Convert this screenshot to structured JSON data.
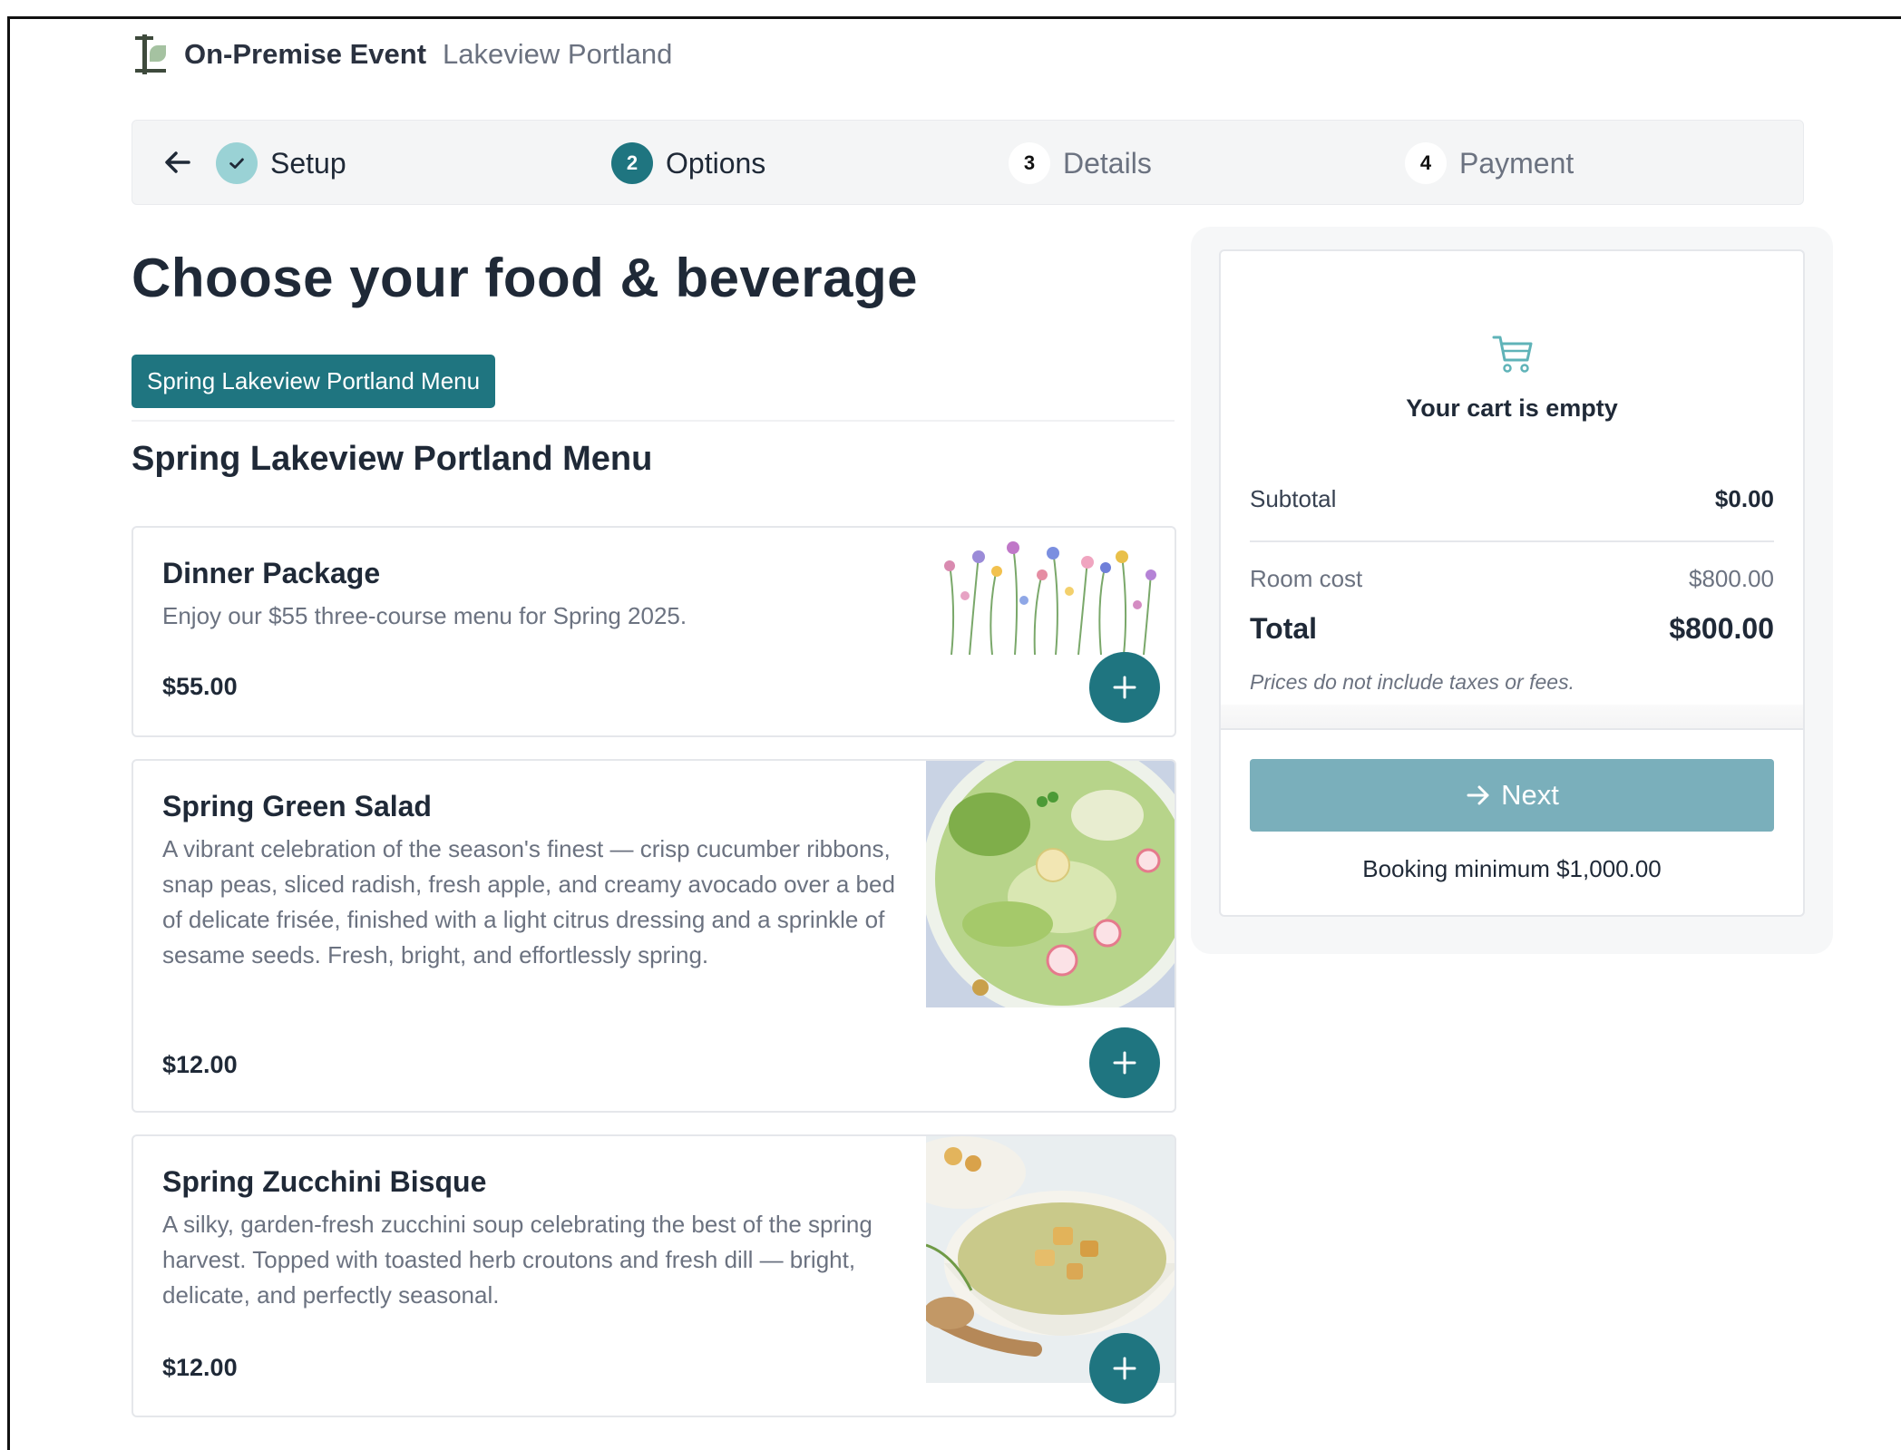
{
  "header": {
    "title": "On-Premise Event",
    "venue": "Lakeview Portland",
    "logo_icon": "leaf-logo-icon"
  },
  "stepper": {
    "back_icon": "arrow-left-icon",
    "steps": [
      {
        "number": "",
        "label": "Setup",
        "state": "complete",
        "icon": "check-icon"
      },
      {
        "number": "2",
        "label": "Options",
        "state": "active"
      },
      {
        "number": "3",
        "label": "Details",
        "state": "upcoming"
      },
      {
        "number": "4",
        "label": "Payment",
        "state": "upcoming"
      }
    ]
  },
  "main": {
    "title": "Choose your food & beverage",
    "menu_tab": "Spring Lakeview Portland Menu",
    "section_title": "Spring Lakeview Portland Menu",
    "items": [
      {
        "name": "Dinner Package",
        "description": "Enjoy our $55 three-course menu for Spring 2025.",
        "price": "$55.00",
        "image": "wildflowers"
      },
      {
        "name": "Spring Green Salad",
        "description": "A vibrant celebration of the season's finest — crisp cucumber ribbons, snap peas, sliced radish, fresh apple, and creamy avocado over a bed of delicate frisée, finished with a light citrus dressing and a sprinkle of sesame seeds. Fresh, bright, and effortlessly spring.",
        "price": "$12.00",
        "image": "salad"
      },
      {
        "name": "Spring Zucchini Bisque",
        "description": "A silky, garden-fresh zucchini soup celebrating the best of the spring harvest. Topped with toasted herb croutons and fresh dill — bright, delicate, and perfectly seasonal.",
        "price": "$12.00",
        "image": "soup"
      }
    ]
  },
  "cart": {
    "icon": "shopping-cart-icon",
    "empty_text": "Your cart is empty",
    "subtotal_label": "Subtotal",
    "subtotal_value": "$0.00",
    "room_cost_label": "Room cost",
    "room_cost_value": "$800.00",
    "total_label": "Total",
    "total_value": "$800.00",
    "disclaimer": "Prices do not include taxes or fees.",
    "next_label": "Next",
    "booking_minimum": "Booking minimum $1,000.00"
  },
  "colors": {
    "accent": "#1f7580",
    "accent_light": "#9ad2d5",
    "next_button": "#7aafbb"
  }
}
